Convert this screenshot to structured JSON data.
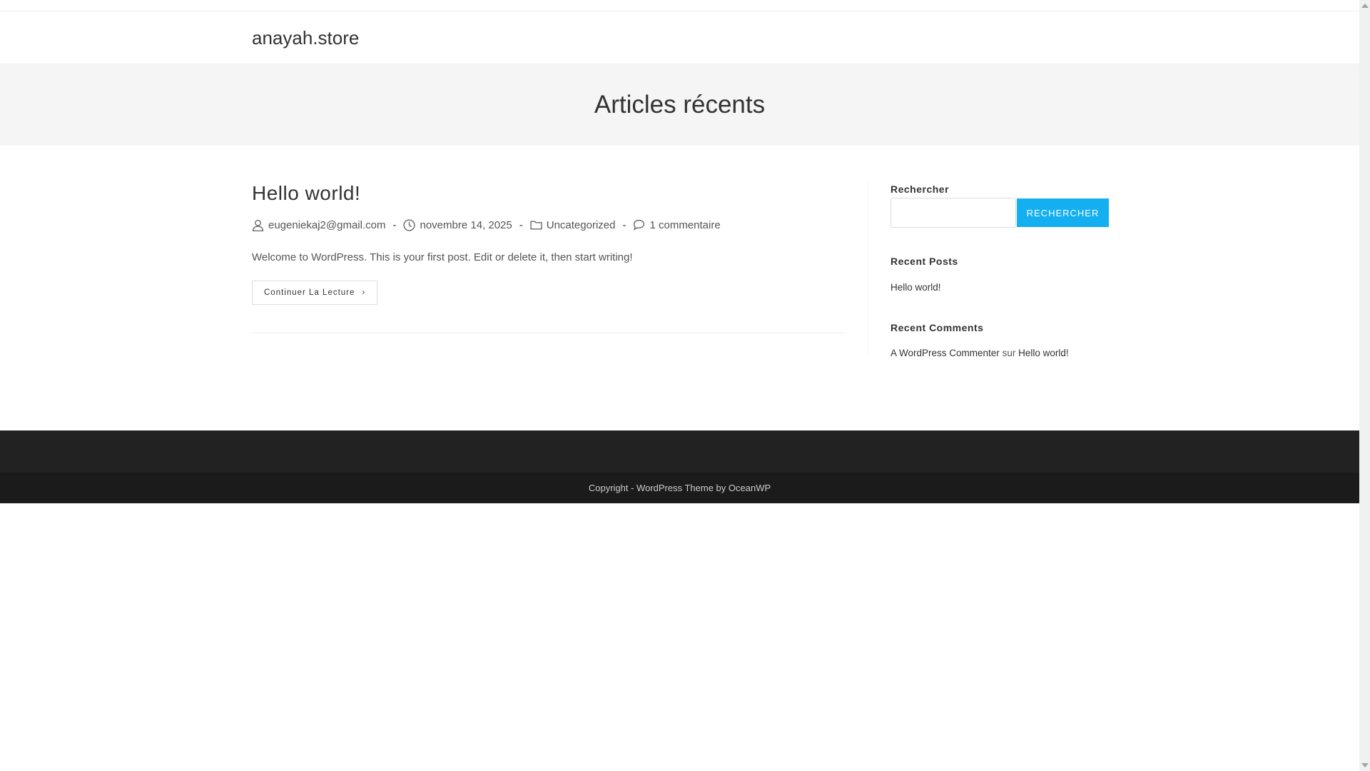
{
  "site": {
    "title": "anayah.store"
  },
  "page_header": {
    "title": "Articles récents"
  },
  "post": {
    "title": "Hello world!",
    "author": "eugeniekaj2@gmail.com",
    "date": "novembre 14, 2025",
    "category": "Uncategorized",
    "comments": "1 commentaire",
    "excerpt": "Welcome to WordPress. This is your first post. Edit or delete it, then start writing!",
    "read_more": "Continuer La Lecture",
    "separator": "-"
  },
  "sidebar": {
    "search_title": "Rechercher",
    "search_input": "",
    "search_button": "RECHERCHER",
    "recent_posts_title": "Recent Posts",
    "recent_posts": [
      "Hello world!"
    ],
    "recent_comments_title": "Recent Comments",
    "comment_author": "A WordPress Commenter",
    "comment_sep": "sur",
    "comment_post": "Hello world!"
  },
  "footer": {
    "copyright": "Copyright - WordPress Theme by OceanWP"
  },
  "colors": {
    "accent": "#13aff0"
  }
}
